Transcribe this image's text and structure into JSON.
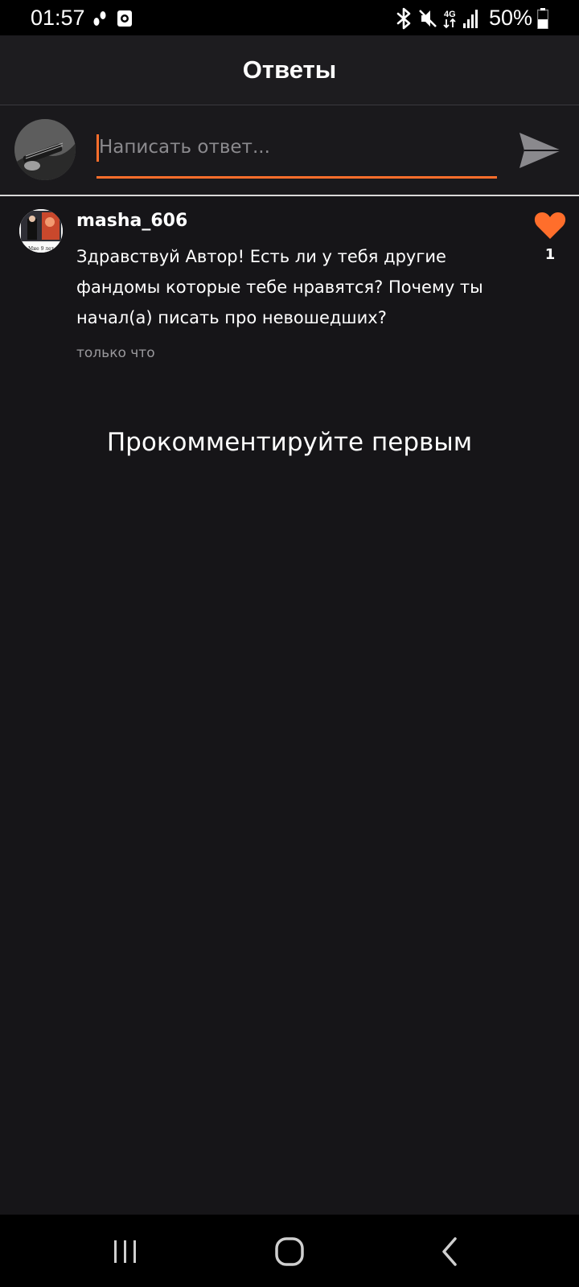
{
  "status_bar": {
    "time": "01:57",
    "battery_percent": "50%",
    "icons": [
      "footsteps-icon",
      "screen-record-icon",
      "bluetooth-icon",
      "mute-icon",
      "4g-icon",
      "signal-icon",
      "battery-icon"
    ]
  },
  "header": {
    "title": "Ответы"
  },
  "composer": {
    "placeholder": "Написать ответ...",
    "value": "",
    "accent_color": "#ff6e2b"
  },
  "comment": {
    "username": "masha_606",
    "avatar_caption": "Мне 9 лет",
    "text": "Здравствуй Автор! Есть ли у тебя другие фандомы которые тебе нравятся? Почему ты начал(а) писать про невошедших?",
    "time": "только что",
    "likes": "1",
    "like_color": "#ff6e2b"
  },
  "empty_state": {
    "message": "Прокомментируйте первым"
  },
  "nav_bar": {
    "buttons": [
      "recent-apps-icon",
      "home-icon",
      "back-icon"
    ]
  }
}
